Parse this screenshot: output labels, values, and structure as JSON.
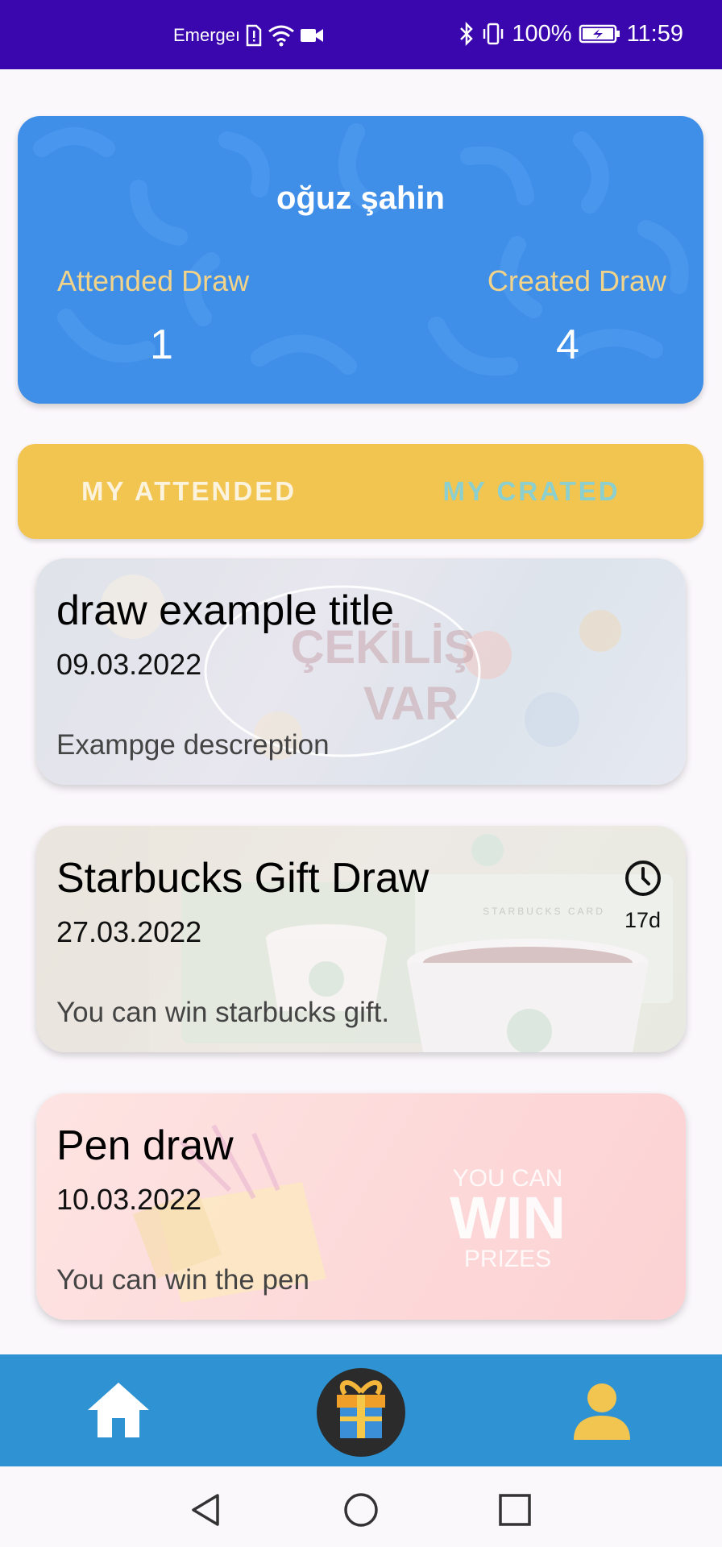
{
  "status_bar": {
    "carrier_text": "Emergeı",
    "battery_percent": "100%",
    "time": "11:59"
  },
  "profile": {
    "name": "oğuz şahin",
    "attended_label": "Attended Draw",
    "attended_count": "1",
    "created_label": "Created Draw",
    "created_count": "4"
  },
  "tabs": [
    {
      "label": "MY ATTENDED",
      "active": true
    },
    {
      "label": "MY CRATED",
      "active": false
    }
  ],
  "draws": [
    {
      "title": "draw example title",
      "date": "09.03.2022",
      "description": "Exampge descreption",
      "overlay_text": [
        "ÇEKİLİŞ",
        "VAR"
      ]
    },
    {
      "title": "Starbucks Gift Draw",
      "date": "27.03.2022",
      "description": "You can win starbucks gift.",
      "days_left": "17d",
      "overlay_text": [
        "STARBUCKS CARD"
      ]
    },
    {
      "title": "Pen draw",
      "date": "10.03.2022",
      "description": "You can win the pen",
      "overlay_text": [
        "YOU CAN",
        "WIN",
        "PRIZES"
      ]
    }
  ],
  "bottom_nav": {
    "items": [
      "home-icon",
      "gift-icon",
      "person-icon"
    ]
  },
  "colors": {
    "status_bar": "#3a06ad",
    "profile_card": "#3f8fe9",
    "tab_bar": "#f2c450",
    "bottom_nav": "#2f93d3",
    "stat_label": "#f2d38a",
    "inactive_tab": "#8ccfcf"
  }
}
